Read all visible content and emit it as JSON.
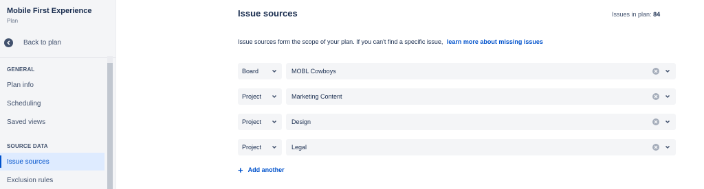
{
  "sidebar": {
    "plan_name": "Mobile First Experience",
    "plan_type": "Plan",
    "back_label": "Back to plan",
    "sections": [
      {
        "heading": "GENERAL",
        "items": [
          "Plan info",
          "Scheduling",
          "Saved views"
        ]
      },
      {
        "heading": "SOURCE DATA",
        "items": [
          "Issue sources",
          "Exclusion rules"
        ]
      }
    ],
    "active_item": "Issue sources"
  },
  "main": {
    "title": "Issue sources",
    "issues_label": "Issues in plan:",
    "issues_count": "84",
    "description": "Issue sources form the scope of your plan. If you can't find a specific issue,",
    "learn_more": "learn more about missing issues",
    "sources": [
      {
        "type": "Board",
        "value": "MOBL Cowboys"
      },
      {
        "type": "Project",
        "value": "Marketing Content"
      },
      {
        "type": "Project",
        "value": "Design"
      },
      {
        "type": "Project",
        "value": "Legal"
      }
    ],
    "add_another": "Add another"
  },
  "colors": {
    "accent": "#0052cc",
    "active_bg": "#deebff",
    "field_bg": "#f4f5f7"
  },
  "icons": {
    "back": "arrow-left-icon",
    "chevron": "chevron-down-icon",
    "clear": "close-icon",
    "add": "plus-icon"
  }
}
